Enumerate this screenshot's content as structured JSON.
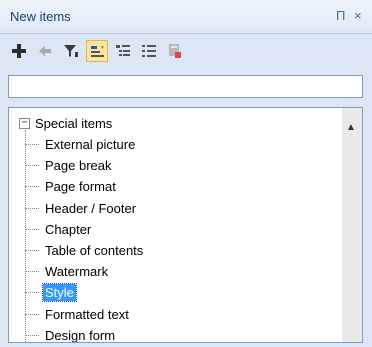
{
  "panel": {
    "title": "New items",
    "pin_glyph": "Π",
    "close_glyph": "×"
  },
  "toolbar": {
    "tools": [
      {
        "name": "add-icon",
        "active": false
      },
      {
        "name": "back-arrow-icon",
        "active": false
      },
      {
        "name": "filter-icon",
        "active": false
      },
      {
        "name": "sort-az-icon",
        "active": true
      },
      {
        "name": "tree-view-icon",
        "active": false
      },
      {
        "name": "list-view-icon",
        "active": false
      },
      {
        "name": "delete-icon",
        "active": false
      }
    ]
  },
  "search": {
    "value": "",
    "placeholder": ""
  },
  "tree": {
    "root_label": "Special items",
    "expander_glyph": "−",
    "scroll_up_glyph": "▲",
    "items": [
      "External picture",
      "Page break",
      "Page format",
      "Header / Footer",
      "Chapter",
      "Table of contents",
      "Watermark",
      "Style",
      "Formatted text",
      "Design form"
    ],
    "selected": "Style"
  },
  "colors": {
    "selection": "#3399ff",
    "title_text": "#1e3d6b",
    "active_tool": "#fbe4a4"
  }
}
